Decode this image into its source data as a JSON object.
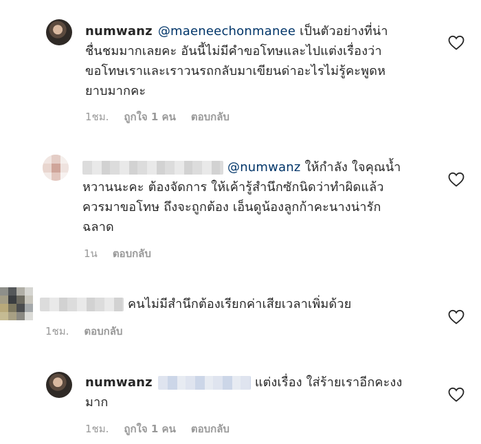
{
  "comments": [
    {
      "username": "numwanz",
      "mention": "@maeneechonmanee",
      "lines": [
        "เป็นตัวอย่างที่น่า",
        "ชื่นชมมากเลยคะ อันนี้ไม่มีคำขอโทษและไปแต่งเรื่องว่า",
        "ขอโทษเราและเราวนรถกลับมาเขียนด่าอะไรไม่รู้คะพูดห",
        "ยาบมากคะ"
      ],
      "time": "1ชม.",
      "likes": "ถูกใจ 1 คน",
      "reply": "ตอบกลับ"
    },
    {
      "mention": "@numwanz",
      "lines": [
        "ให้กำลัง ใจคุณน้ำ",
        "หวานนะคะ ต้องจัดการ ให้เค้ารู้สำนึกซักนิดว่าทำผิดแล้ว",
        "ควรมาขอโทษ ถึงจะถูกต้อง เอ็นดูน้องลูกก้าคะนางน่ารัก",
        "ฉลาด"
      ],
      "time": "1น",
      "reply": "ตอบกลับ"
    },
    {
      "lines": [
        "คนไม่มีสำนึกต้องเรียกค่าเสียเวลาเพิ่มด้วย"
      ],
      "time": "1ชม.",
      "reply": "ตอบกลับ"
    },
    {
      "username": "numwanz",
      "lines": [
        "แต่งเรื่อง ใส่ร้ายเราอีกคะงง",
        "มาก"
      ],
      "time": "1ชม.",
      "likes": "ถูกใจ 1 คน",
      "reply": "ตอบกลับ"
    }
  ],
  "icons": {
    "like": "heart-outline-icon"
  },
  "colors": {
    "mention": "#003569",
    "meta": "#999999",
    "text": "#262626"
  }
}
